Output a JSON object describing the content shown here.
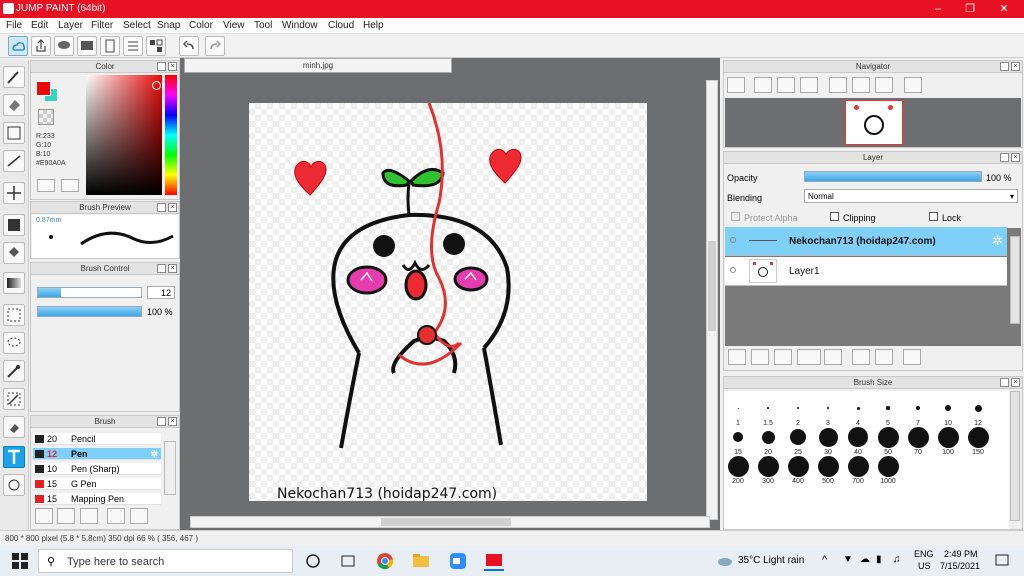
{
  "window": {
    "title": "JUMP PAINT (64bit)"
  },
  "menu": [
    "File",
    "Edit",
    "Layer",
    "Filter",
    "Select",
    "Snap",
    "Color",
    "View",
    "Tool",
    "Window",
    "Cloud",
    "Help"
  ],
  "color_panel": {
    "title": "Color",
    "r": "R:233",
    "g": "G:10",
    "b": "B:10",
    "hex": "#E90A0A",
    "main_color": "#E90A0A",
    "sub_color": "#2fd6c0"
  },
  "brush_preview": {
    "title": "Brush Preview",
    "size": "0.87mm"
  },
  "brush_control": {
    "title": "Brush Control",
    "size_value": "12",
    "opacity_value": "100 %",
    "size_fraction": 0.22,
    "opacity_fraction": 1.0
  },
  "brush_panel": {
    "title": "Brush",
    "items": [
      {
        "size": "20",
        "name": "Pencil",
        "color": "#222222"
      },
      {
        "size": "12",
        "name": "Pen",
        "color": "#222222",
        "selected": true
      },
      {
        "size": "10",
        "name": "Pen (Sharp)",
        "color": "#222222"
      },
      {
        "size": "15",
        "name": "G Pen",
        "color": "#e62020"
      },
      {
        "size": "15",
        "name": "Mapping Pen",
        "color": "#e62020"
      }
    ]
  },
  "document": {
    "tab": "minh.jpg",
    "signature": "Nekochan713 (hoidap247.com)"
  },
  "navigator": {
    "title": "Navigator"
  },
  "layer_panel": {
    "title": "Layer",
    "opacity_label": "Opacity",
    "opacity_value": "100 %",
    "blending_label": "Blending",
    "blending_value": "Normal",
    "protect_alpha": "Protect Alpha",
    "clipping": "Clipping",
    "lock": "Lock",
    "layers": [
      {
        "name": "Nekochan713 (hoidap247.com)",
        "selected": true
      },
      {
        "name": "Layer1",
        "selected": false
      }
    ]
  },
  "brush_size": {
    "title": "Brush Size",
    "sizes": [
      "1",
      "1.5",
      "2",
      "3",
      "4",
      "5",
      "7",
      "10",
      "12",
      "15",
      "20",
      "25",
      "30",
      "40",
      "50",
      "70",
      "100",
      "150",
      "200",
      "300",
      "400",
      "500",
      "700",
      "1000"
    ]
  },
  "status": {
    "text": "800 * 800 pixel   (5.8 * 5.8cm)   350 dpi   66 %   ( 356, 467 )"
  },
  "taskbar": {
    "search_placeholder": "Type here to search",
    "weather": "35°C  Light rain",
    "lang1": "ENG",
    "lang2": "US",
    "time": "2:49 PM",
    "date": "7/15/2021"
  }
}
